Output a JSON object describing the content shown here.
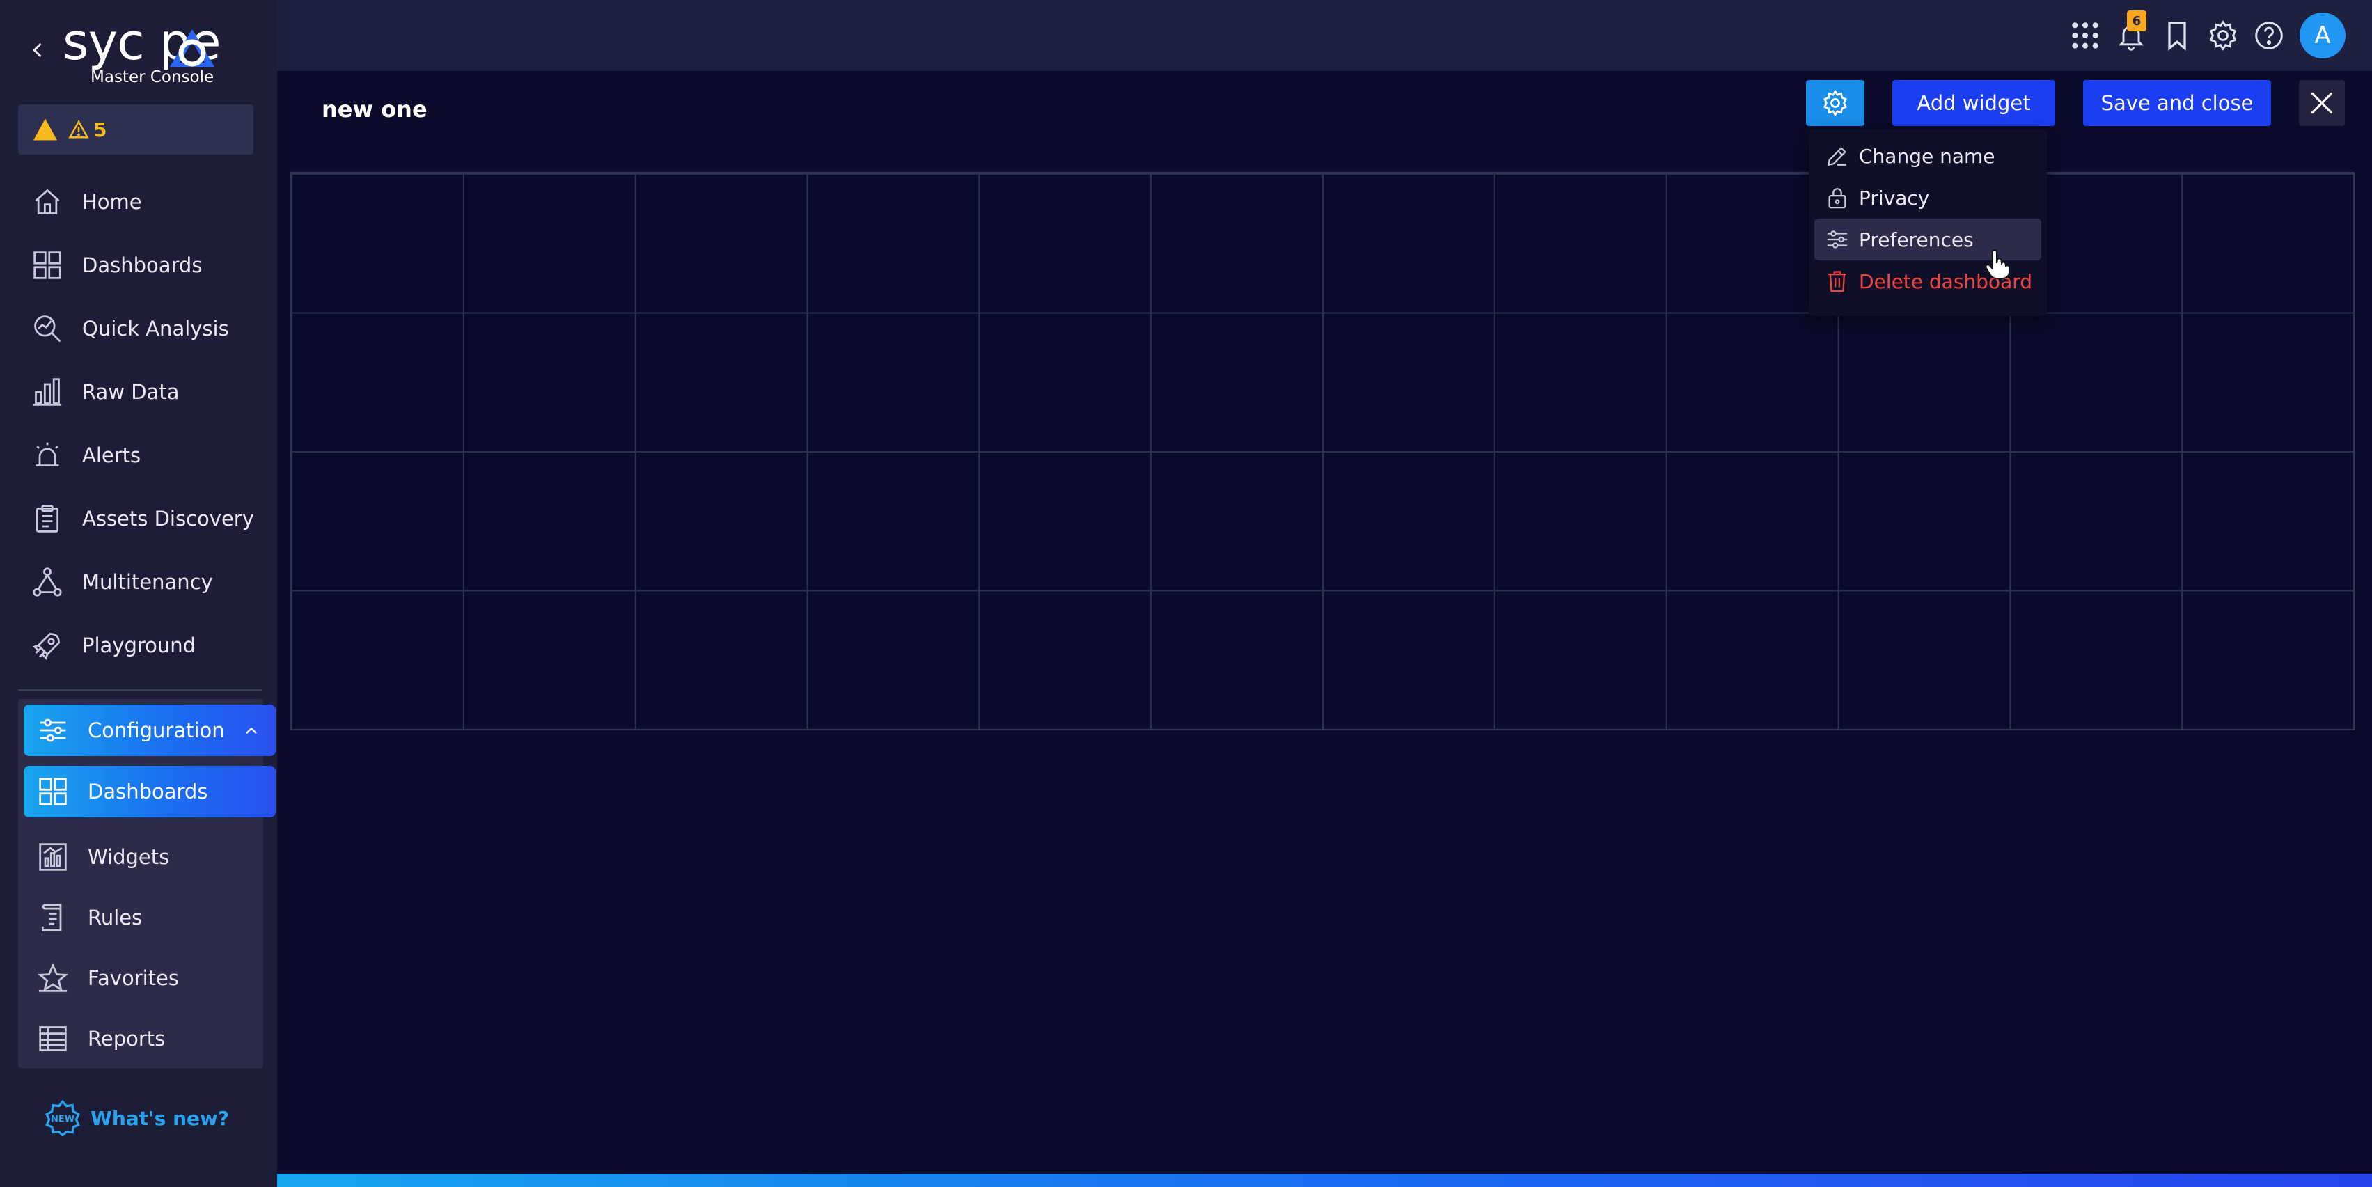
{
  "brand": {
    "logo_text": "syc pe",
    "subtitle": "Master Console"
  },
  "alerts": {
    "count": "5"
  },
  "nav": [
    {
      "label": "Home",
      "icon": "home-icon"
    },
    {
      "label": "Dashboards",
      "icon": "grid-icon"
    },
    {
      "label": "Quick Analysis",
      "icon": "analysis-icon"
    },
    {
      "label": "Raw Data",
      "icon": "bar-chart-icon"
    },
    {
      "label": "Alerts",
      "icon": "alarm-icon"
    },
    {
      "label": "Assets Discovery",
      "icon": "clipboard-icon"
    },
    {
      "label": "Multitenancy",
      "icon": "network-icon"
    },
    {
      "label": "Playground",
      "icon": "rocket-icon"
    }
  ],
  "configuration": {
    "label": "Configuration",
    "items": [
      {
        "label": "Dashboards"
      },
      {
        "label": "Widgets"
      },
      {
        "label": "Rules"
      },
      {
        "label": "Favorites"
      },
      {
        "label": "Reports"
      }
    ]
  },
  "whats_new": "What's new?",
  "topbar": {
    "notification_count": "6",
    "avatar_letter": "A"
  },
  "main": {
    "title": "new one",
    "add_widget": "Add widget",
    "save_close": "Save and close"
  },
  "menu": {
    "change_name": "Change name",
    "privacy": "Privacy",
    "preferences": "Preferences",
    "delete_dashboard": "Delete dashboard"
  },
  "colors": {
    "accent": "#1a3ef0",
    "accent_gradient_start": "#18a5ee",
    "warning": "#f9b91d",
    "danger": "#ef4444",
    "background": "#0a0b2a",
    "sidebar": "#1c1e38"
  }
}
